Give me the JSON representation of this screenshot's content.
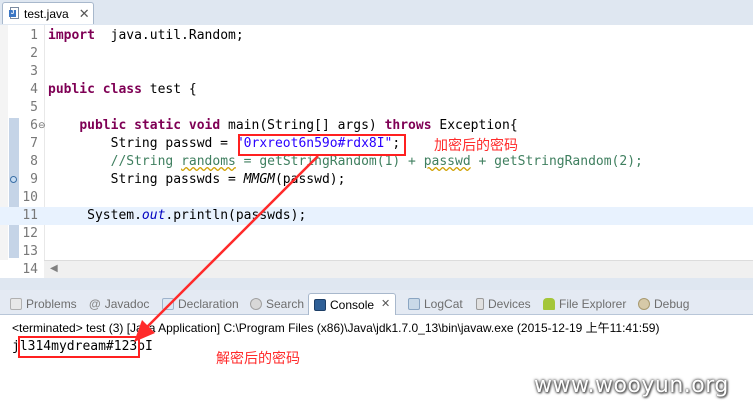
{
  "editor_tab": {
    "label": "test.java",
    "close": "✕"
  },
  "code": {
    "lines": [
      {
        "n": "1",
        "parts": [
          [
            "kw",
            "import"
          ],
          [
            "",
            "  java.util.Random;"
          ]
        ]
      },
      {
        "n": "2",
        "parts": []
      },
      {
        "n": "3",
        "parts": []
      },
      {
        "n": "4",
        "parts": [
          [
            "kw",
            "public class"
          ],
          [
            "",
            " test {"
          ]
        ]
      },
      {
        "n": "5",
        "parts": []
      },
      {
        "n": "6",
        "parts": [
          [
            "",
            "    "
          ],
          [
            "kw",
            "public static void"
          ],
          [
            "",
            " main(String[] args) "
          ],
          [
            "kw",
            "throws"
          ],
          [
            "",
            " Exception{"
          ]
        ]
      },
      {
        "n": "7",
        "parts": [
          [
            "",
            "        String passwd = "
          ],
          [
            "str",
            "\"0rxreot6n59o#rdx8I\""
          ],
          [
            "",
            ";"
          ]
        ]
      },
      {
        "n": "8",
        "parts": [
          [
            "cmt",
            "        //String "
          ],
          [
            "cmtsq",
            "randoms"
          ],
          [
            "cmt",
            " = getStringRandom(1) + "
          ],
          [
            "cmtsq",
            "passwd"
          ],
          [
            "cmt",
            " + getStringRandom(2);"
          ]
        ]
      },
      {
        "n": "9",
        "parts": [
          [
            "",
            "        String passwds = "
          ],
          [
            "ital",
            "MMGM"
          ],
          [
            "",
            "(passwd);"
          ]
        ]
      },
      {
        "n": "10",
        "parts": []
      },
      {
        "n": "11",
        "parts": [
          [
            "",
            "     System."
          ],
          [
            "field",
            "out"
          ],
          [
            "",
            ".println(passwds);"
          ]
        ]
      },
      {
        "n": "12",
        "parts": []
      },
      {
        "n": "13",
        "parts": []
      },
      {
        "n": "14",
        "parts": [
          [
            "",
            "    }"
          ]
        ]
      }
    ]
  },
  "annotations": {
    "encrypted": "加密后的密码",
    "decrypted": "解密后的密码"
  },
  "views": {
    "tabs": [
      {
        "label": "Problems",
        "icon": "problems-icon"
      },
      {
        "label": "Javadoc",
        "icon": "javadoc-icon"
      },
      {
        "label": "Declaration",
        "icon": "declaration-icon"
      },
      {
        "label": "Search",
        "icon": "search-icon"
      },
      {
        "label": "Console",
        "icon": "console-icon",
        "active": true
      },
      {
        "label": "LogCat",
        "icon": "logcat-icon"
      },
      {
        "label": "Devices",
        "icon": "devices-icon"
      },
      {
        "label": "File Explorer",
        "icon": "file-explorer-icon"
      },
      {
        "label": "Debug",
        "icon": "debug-icon"
      }
    ]
  },
  "console": {
    "terminated": "<terminated> test (3) [Java Application] C:\\Program Files (x86)\\Java\\jdk1.7.0_13\\bin\\javaw.exe (2015-12-19 上午11:41:59)",
    "output": "jl314mydream#123oI"
  },
  "watermark": "www.wooyun.org",
  "colors": {
    "annotation": "#ff2020",
    "keyword": "#7f0055",
    "string": "#2a00ff",
    "comment": "#3f7f5f"
  }
}
